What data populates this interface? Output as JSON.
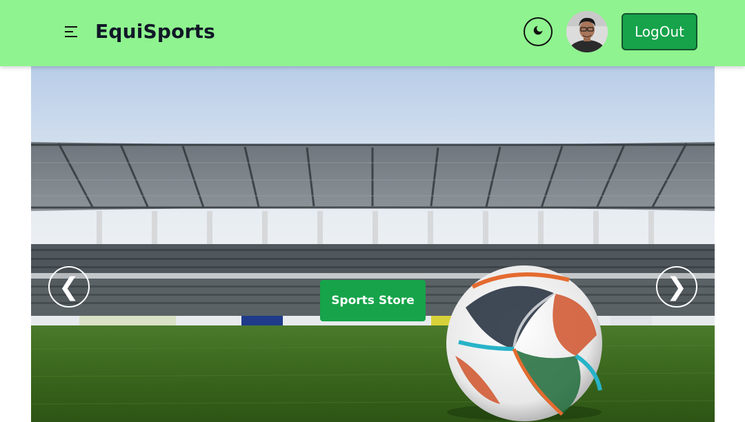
{
  "navbar": {
    "brand": "EquiSports",
    "menu_icon": "menu-icon",
    "theme_icon": "moon-icon",
    "avatar_icon": "user-avatar",
    "logout_label": "LogOut"
  },
  "hero": {
    "cta_label": "Sports Store",
    "prev_label": "❮",
    "next_label": "❯"
  },
  "colors": {
    "navbar_bg": "#8ff38f",
    "accent": "#16a34a",
    "text_dark": "#111827"
  }
}
